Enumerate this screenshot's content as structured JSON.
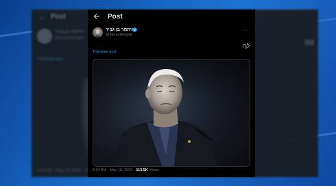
{
  "background_post": {
    "back_glyph": "←",
    "title": "Post",
    "display_name": "איתמר בן גביר",
    "handle": "@itamarbengvir",
    "translate_label": "Translate post",
    "meta": "8:34 AM · May 18, 2024 · 113.5K Views"
  },
  "post": {
    "header": {
      "back_icon": "arrow-left-icon",
      "title": "Post"
    },
    "author": {
      "display_name": "איתמר בן גביר",
      "verified": true,
      "verified_color": "#1d9bf0",
      "handle": "@itamarbengvir"
    },
    "more_glyph": "···",
    "text": "לך!",
    "translate_label": "Translate post",
    "media": {
      "description": "photo-of-man-in-dark-suit"
    },
    "meta": {
      "time": "8:34 AM",
      "separator1": " · ",
      "date": "May 18, 2024",
      "separator2": " · ",
      "views_count": "113.5K",
      "views_label": " Views"
    }
  },
  "colors": {
    "page_background": "#1565c0",
    "post_background": "#000000",
    "link": "#1d9bf0",
    "secondary_text": "#71767b",
    "primary_text": "#e7e9ea"
  }
}
